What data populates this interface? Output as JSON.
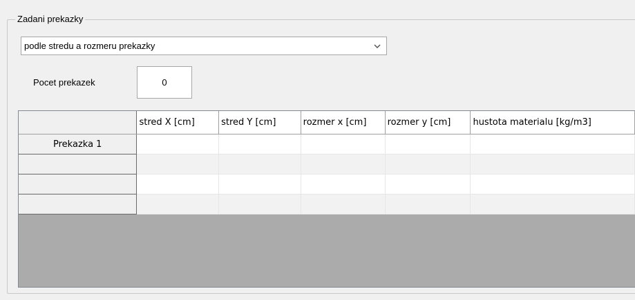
{
  "group": {
    "title": "Zadani prekazky"
  },
  "mode_select": {
    "value": "podle stredu a rozmeru prekazky"
  },
  "count": {
    "label": "Pocet prekazek",
    "value": "0"
  },
  "grid": {
    "columns": [
      "stred X [cm]",
      "stred Y [cm]",
      "rozmer x [cm]",
      "rozmer y [cm]",
      "hustota materialu [kg/m3]"
    ],
    "rows": [
      {
        "header": "Prekazka 1",
        "cells": [
          "",
          "",
          "",
          "",
          ""
        ]
      },
      {
        "header": "",
        "cells": [
          "",
          "",
          "",
          "",
          ""
        ]
      },
      {
        "header": "",
        "cells": [
          "",
          "",
          "",
          "",
          ""
        ]
      },
      {
        "header": "",
        "cells": [
          "",
          "",
          "",
          "",
          ""
        ]
      }
    ]
  }
}
